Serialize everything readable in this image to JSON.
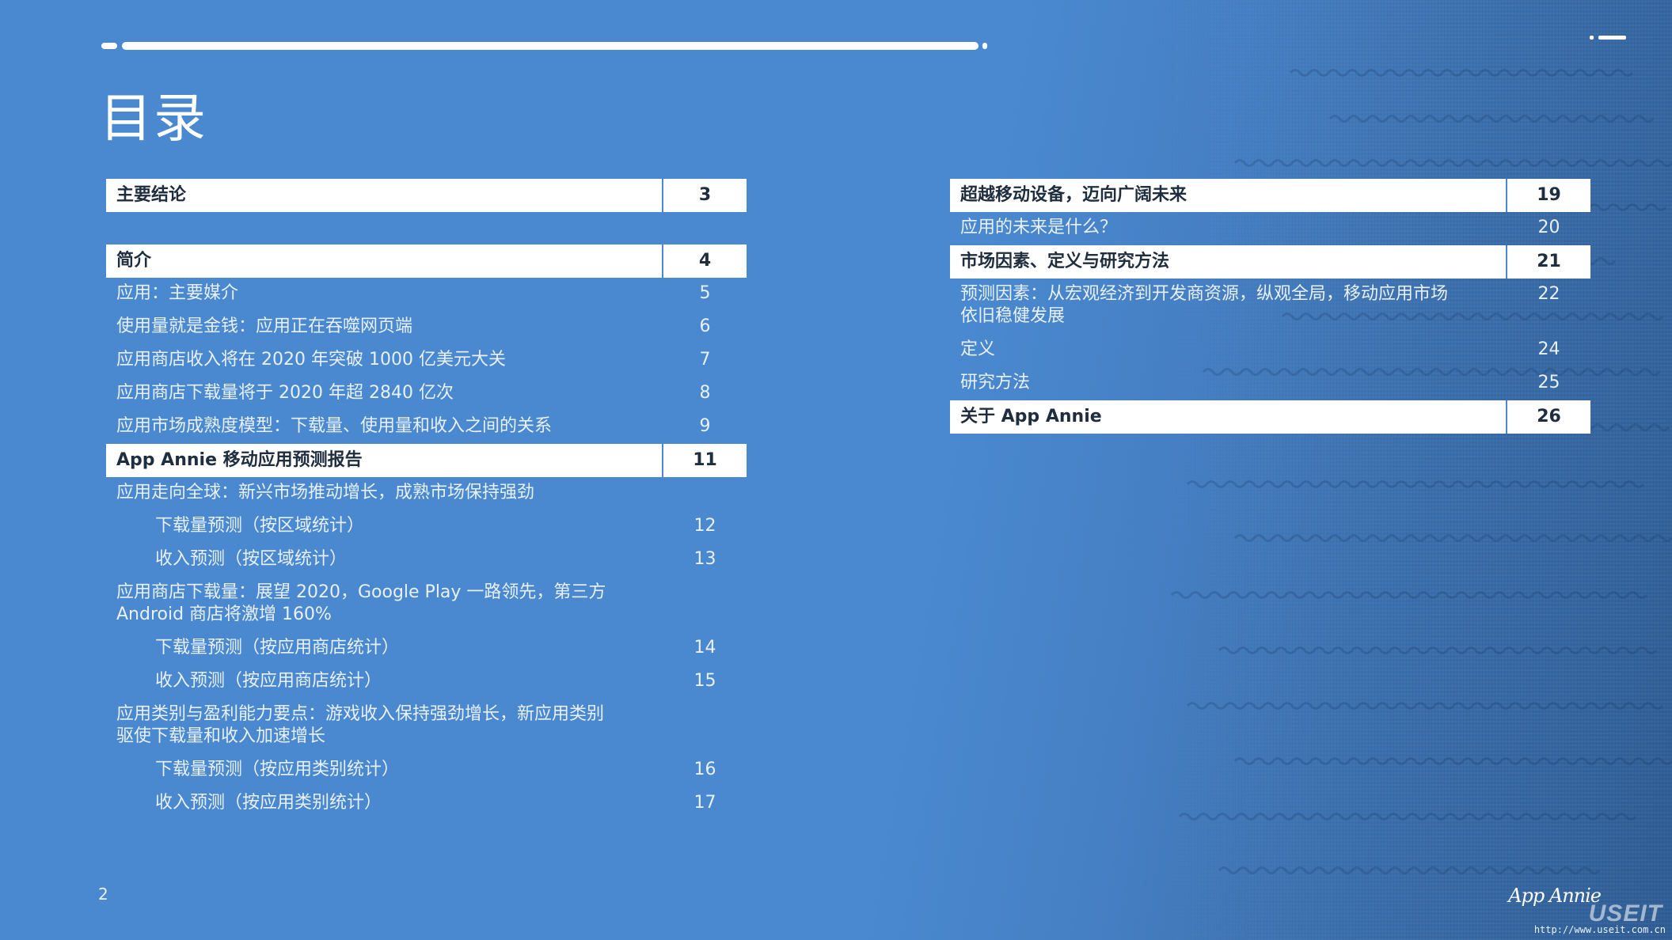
{
  "page": {
    "title": "目录",
    "page_number": "2"
  },
  "toc_left": [
    {
      "text": "主要结论",
      "page": "3",
      "style": "major",
      "gap_after": true
    },
    {
      "text": "简介",
      "page": "4",
      "style": "major"
    },
    {
      "text": "应用：主要媒介",
      "page": "5",
      "style": "minor"
    },
    {
      "text": "使用量就是金钱：应用正在吞噬网页端",
      "page": "6",
      "style": "minor"
    },
    {
      "text": "应用商店收入将在 2020 年突破 1000 亿美元大关",
      "page": "7",
      "style": "minor"
    },
    {
      "text": "应用商店下载量将于 2020 年超 2840 亿次",
      "page": "8",
      "style": "minor"
    },
    {
      "text": "应用市场成熟度模型：下载量、使用量和收入之间的关系",
      "page": "9",
      "style": "minor"
    },
    {
      "text": "App Annie 移动应用预测报告",
      "page": "11",
      "style": "major"
    },
    {
      "text": "应用走向全球：新兴市场推动增长，成熟市场保持强劲",
      "page": "",
      "style": "minor"
    },
    {
      "text": "下载量预测（按区域统计）",
      "page": "12",
      "style": "minor indent"
    },
    {
      "text": "收入预测（按区域统计）",
      "page": "13",
      "style": "minor indent"
    },
    {
      "text": "应用商店下载量：展望 2020，Google Play 一路领先，第三方\nAndroid 商店将激增 160%",
      "page": "",
      "style": "minor"
    },
    {
      "text": "下载量预测（按应用商店统计）",
      "page": "14",
      "style": "minor indent"
    },
    {
      "text": "收入预测（按应用商店统计）",
      "page": "15",
      "style": "minor indent"
    },
    {
      "text": "应用类别与盈利能力要点：游戏收入保持强劲增长，新应用类别\n驱使下载量和收入加速增长",
      "page": "",
      "style": "minor"
    },
    {
      "text": "下载量预测（按应用类别统计）",
      "page": "16",
      "style": "minor indent"
    },
    {
      "text": "收入预测（按应用类别统计）",
      "page": "17",
      "style": "minor indent"
    }
  ],
  "toc_right": [
    {
      "text": "超越移动设备，迈向广阔未来",
      "page": "19",
      "style": "major"
    },
    {
      "text": "应用的未来是什么？",
      "page": "20",
      "style": "minor"
    },
    {
      "text": "市场因素、定义与研究方法",
      "page": "21",
      "style": "major"
    },
    {
      "text": "预测因素：从宏观经济到开发商资源，纵观全局，移动应用市场\n依旧稳健发展",
      "page": "22",
      "style": "minor"
    },
    {
      "text": "定义",
      "page": "24",
      "style": "minor"
    },
    {
      "text": "研究方法",
      "page": "25",
      "style": "minor"
    },
    {
      "text": "关于 App Annie",
      "page": "26",
      "style": "major"
    }
  ],
  "branding": {
    "logo_text": "App Annie",
    "watermark_text": "USEIT",
    "watermark_url": "http://www.useit.com.cn"
  },
  "colors": {
    "background": "#4a89d0",
    "background_dark": "#2f5d95",
    "major_row_bg": "#ffffff",
    "major_row_text": "#1f2e3f",
    "text": "#ffffff"
  }
}
